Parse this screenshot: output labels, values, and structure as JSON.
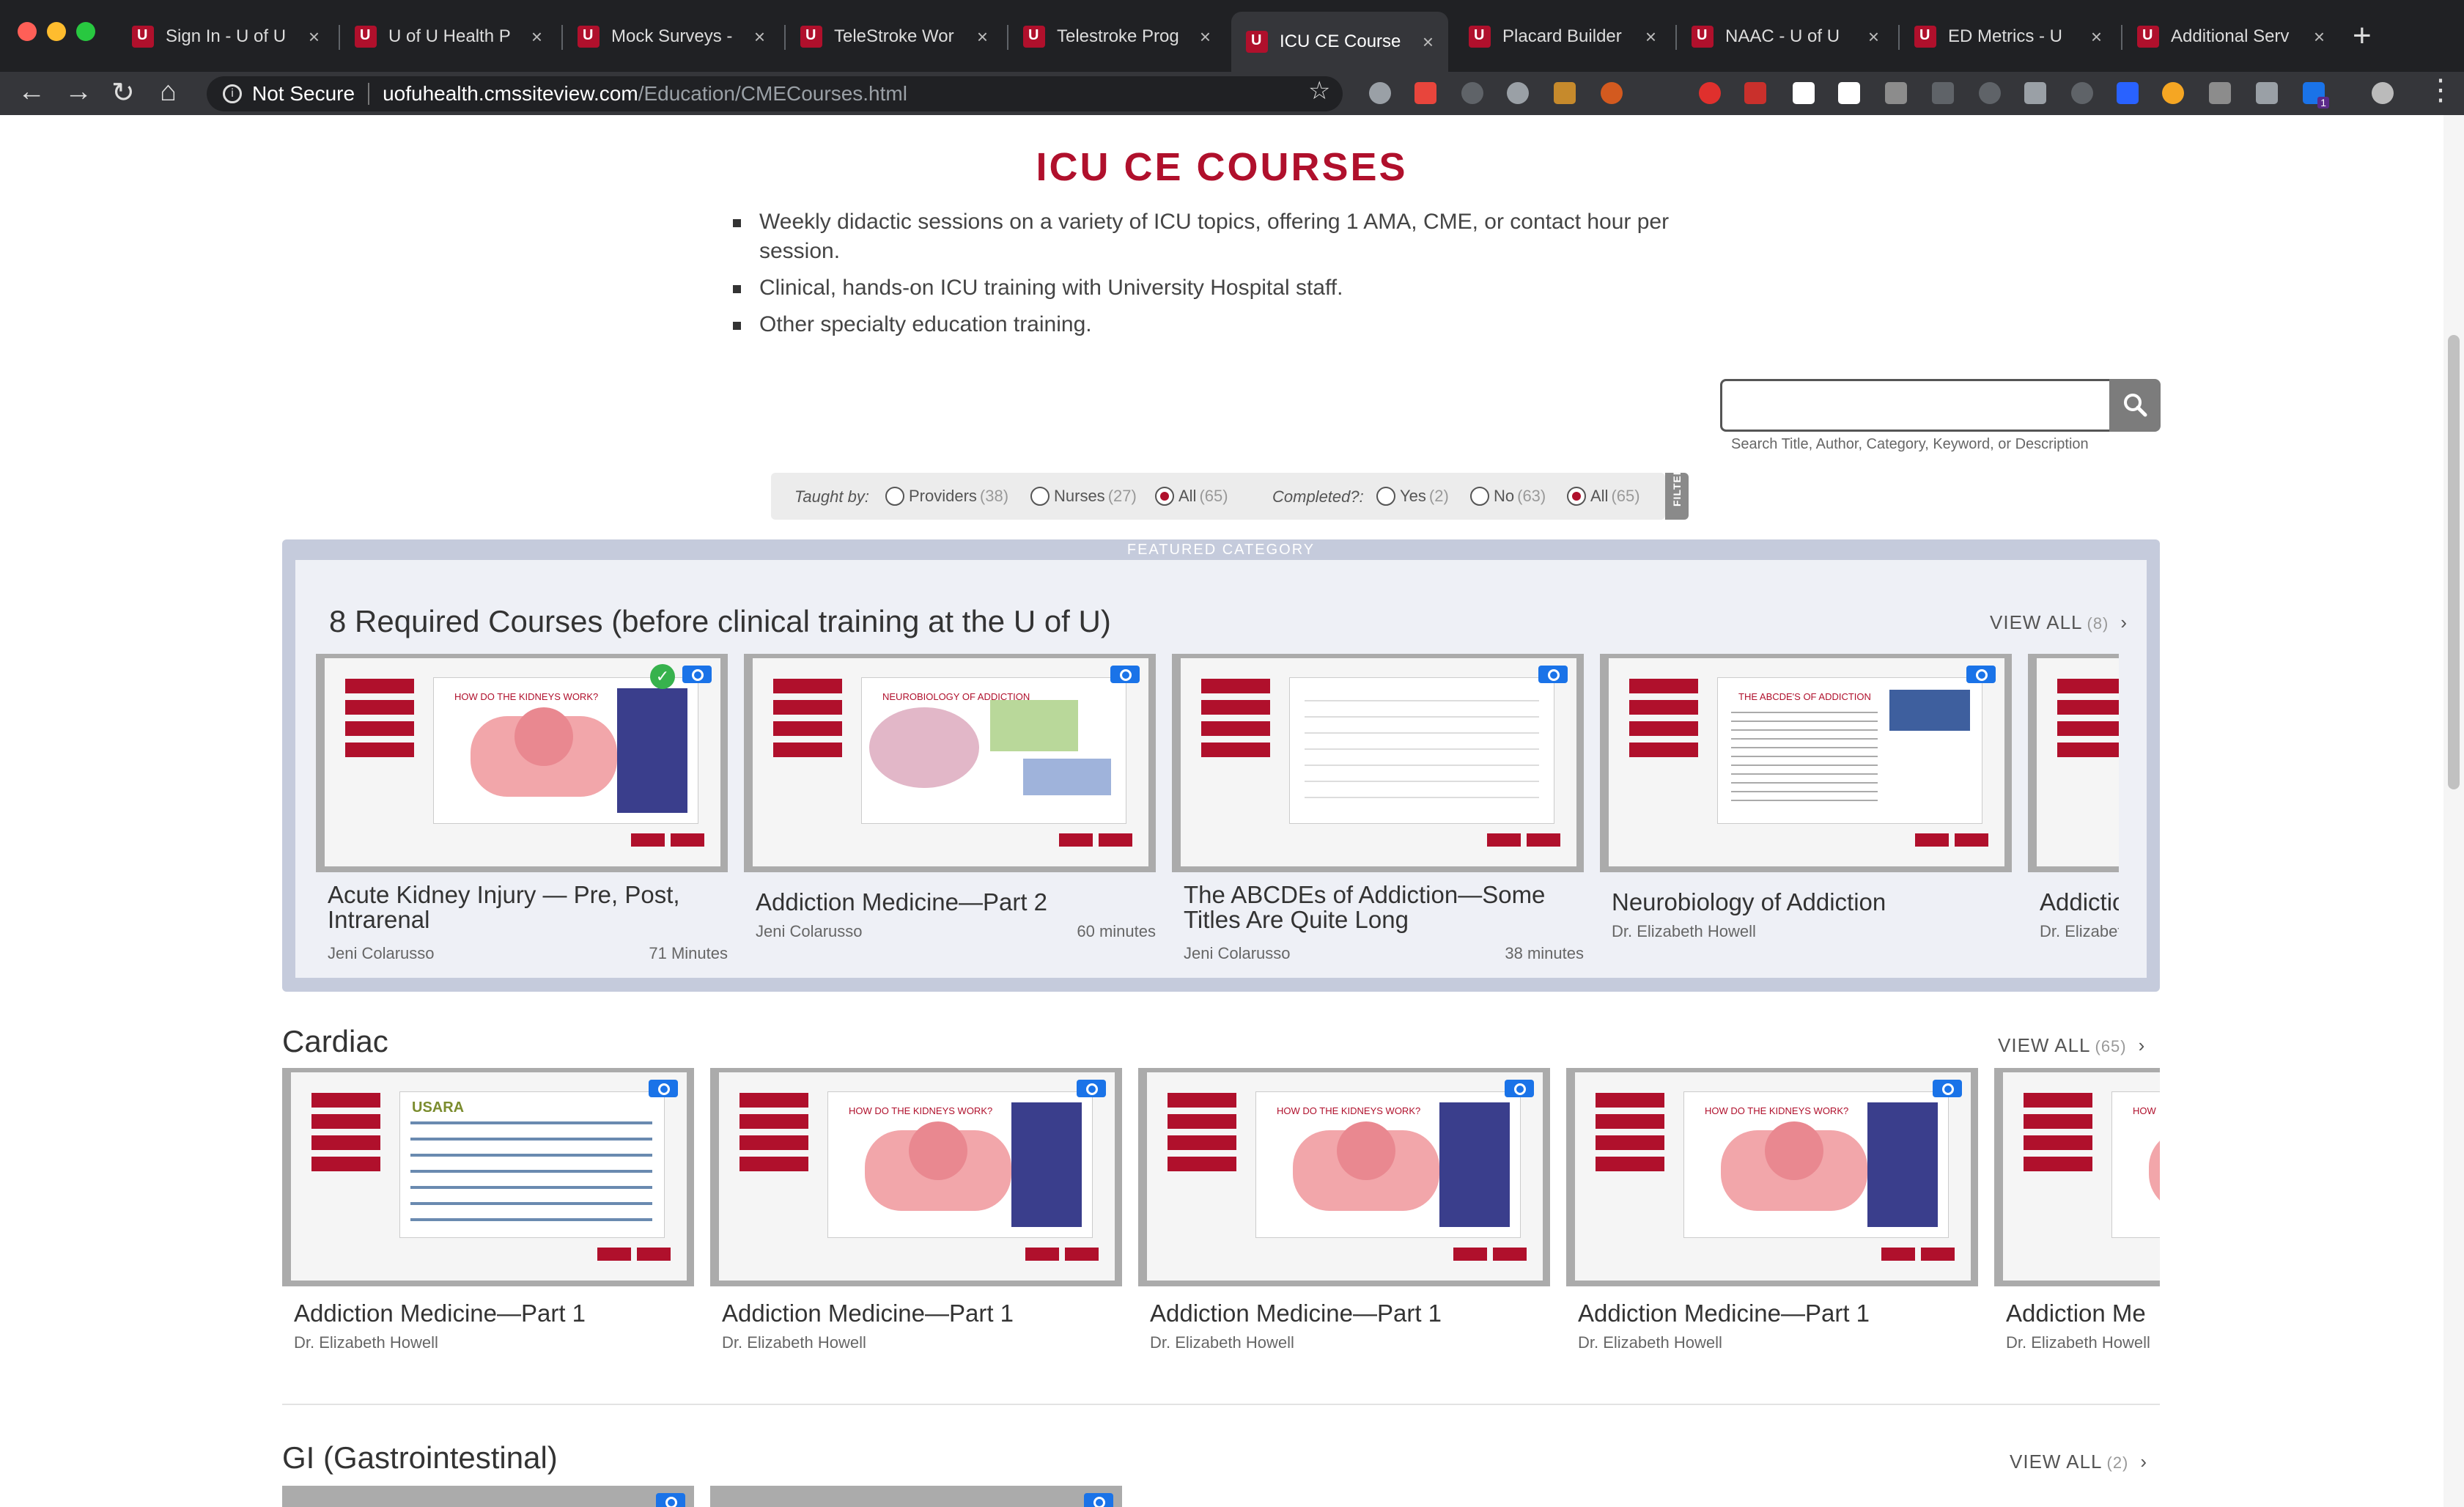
{
  "browser": {
    "tabs": [
      {
        "title": "Sign In - U of U"
      },
      {
        "title": "U of U Health P"
      },
      {
        "title": "Mock Surveys -"
      },
      {
        "title": "TeleStroke Wor"
      },
      {
        "title": "Telestroke Prog"
      },
      {
        "title": "ICU CE Course"
      },
      {
        "title": "Placard Builder"
      },
      {
        "title": "NAAC - U of U"
      },
      {
        "title": "ED Metrics - U"
      },
      {
        "title": "Additional Serv"
      }
    ],
    "security_label": "Not Secure",
    "url_host": "uofuhealth.cmssiteview.com",
    "url_path": "/Education/CMECourses.html",
    "extension_badge": "1"
  },
  "page": {
    "title": "ICU CE COURSES",
    "intro": [
      "Weekly didactic sessions on a variety of ICU topics, offering 1 AMA, CME, or contact hour per session.",
      "Clinical, hands-on ICU training with University Hospital staff.",
      "Other specialty education training."
    ],
    "search": {
      "value": "",
      "hint": "Search Title, Author, Category, Keyword, or Description"
    },
    "filters": {
      "taught_by_label": "Taught by:",
      "taught_by": [
        {
          "label": "Providers",
          "count": "(38)",
          "selected": false
        },
        {
          "label": "Nurses",
          "count": "(27)",
          "selected": false
        },
        {
          "label": "All",
          "count": "(65)",
          "selected": true
        }
      ],
      "completed_label": "Completed?:",
      "completed": [
        {
          "label": "Yes",
          "count": "(2)",
          "selected": false
        },
        {
          "label": "No",
          "count": "(63)",
          "selected": false
        },
        {
          "label": "All",
          "count": "(65)",
          "selected": true
        }
      ],
      "filter_tab": "FILTER"
    },
    "featured": {
      "tag": "FEATURED CATEGORY",
      "title": "8 Required Courses (before clinical training at the U of U)",
      "view_all": "VIEW ALL",
      "view_all_count": "(8)",
      "cards": [
        {
          "title": "Acute Kidney Injury — Pre, Post, Intrarenal",
          "author": "Jeni Colarusso",
          "duration": "71 Minutes",
          "completed": true,
          "thumb_title": "HOW DO THE KIDNEYS WORK?"
        },
        {
          "title": "Addiction Medicine—Part 2",
          "author": "Jeni Colarusso",
          "duration": "60 minutes",
          "thumb_title": "NEUROBIOLOGY OF ADDICTION"
        },
        {
          "title": "The ABCDEs of Addiction—Some Titles Are Quite Long",
          "author": "Jeni Colarusso",
          "duration": "38 minutes"
        },
        {
          "title": "Neurobiology of Addiction",
          "author": "Dr. Elizabeth Howell",
          "duration": "",
          "thumb_title": "THE ABCDE'S OF ADDICTION"
        },
        {
          "title": "Addiction",
          "author": "Dr. Elizabeth",
          "duration": ""
        }
      ]
    },
    "cardiac": {
      "title": "Cardiac",
      "view_all": "VIEW ALL",
      "view_all_count": "(65)",
      "cards": [
        {
          "title": "Addiction Medicine—Part 1",
          "author": "Dr. Elizabeth Howell",
          "thumb_title": "USARA"
        },
        {
          "title": "Addiction Medicine—Part 1",
          "author": "Dr. Elizabeth Howell",
          "thumb_title": "HOW DO THE KIDNEYS WORK?"
        },
        {
          "title": "Addiction Medicine—Part 1",
          "author": "Dr. Elizabeth Howell",
          "thumb_title": "HOW DO THE KIDNEYS WORK?"
        },
        {
          "title": "Addiction Medicine—Part 1",
          "author": "Dr. Elizabeth Howell",
          "thumb_title": "HOW DO THE KIDNEYS WORK?"
        },
        {
          "title": "Addiction Me",
          "author": "Dr. Elizabeth Howell",
          "thumb_title": "HOW"
        }
      ]
    },
    "gi": {
      "title": "GI (Gastrointestinal)",
      "view_all": "VIEW ALL",
      "view_all_count": "(2)"
    }
  },
  "colors": {
    "brand": "#b0102c",
    "featured_bg": "#c5cbdc"
  },
  "icons": [
    "search-icon",
    "chevron-right-icon",
    "info-icon",
    "star-icon",
    "play-icon",
    "checkmark-icon"
  ]
}
